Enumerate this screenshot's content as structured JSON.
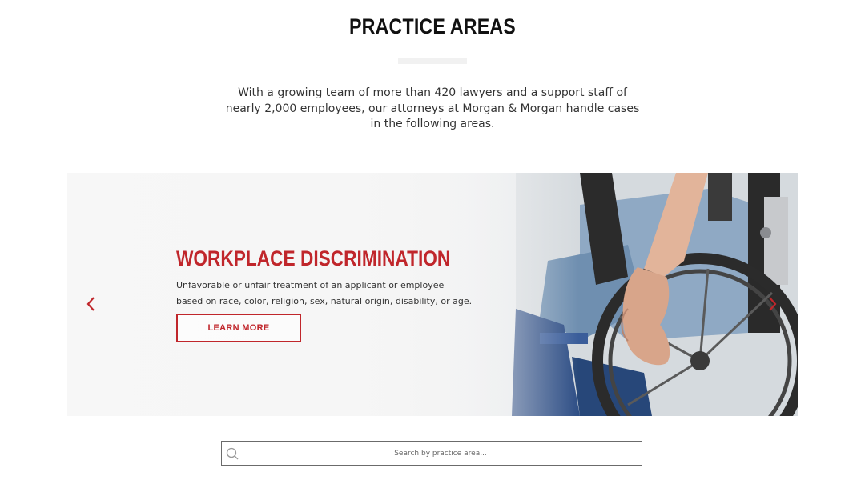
{
  "section": {
    "title": "PRACTICE AREAS",
    "intro": "With a growing team of more than 420 lawyers and a support staff of nearly 2,000 employees, our attorneys at Morgan & Morgan handle cases in the following areas."
  },
  "slide": {
    "heading": "WORKPLACE DISCRIMINATION",
    "description": "Unfavorable or unfair treatment of an applicant or employee based on race, color, religion, sex, natural origin, disability, or age.",
    "button_label": "LEARN MORE",
    "image": "wheelchair-photo",
    "prev_icon": "chevron-left-icon",
    "next_icon": "chevron-right-icon"
  },
  "search": {
    "placeholder": "Search by practice area...",
    "value": "",
    "icon": "search-icon"
  },
  "colors": {
    "accent": "#c0262b",
    "title_text": "#111111",
    "body_text": "#333333",
    "divider": "#f1f1f1",
    "search_border": "#6b6b6b"
  }
}
